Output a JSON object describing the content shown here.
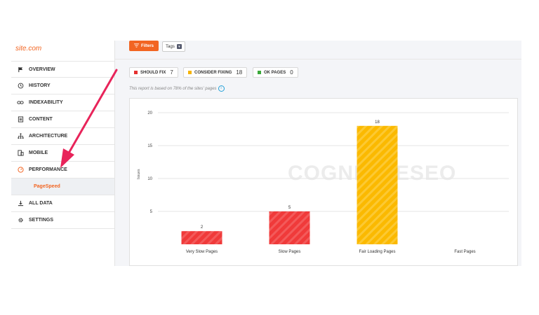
{
  "sidebar": {
    "site_title": "site.com",
    "items": [
      {
        "label": "OVERVIEW",
        "icon": "flag-icon"
      },
      {
        "label": "HISTORY",
        "icon": "history-icon"
      },
      {
        "label": "INDEXABILITY",
        "icon": "link-icon"
      },
      {
        "label": "CONTENT",
        "icon": "document-icon"
      },
      {
        "label": "ARCHITECTURE",
        "icon": "sitemap-icon"
      },
      {
        "label": "MOBILE",
        "icon": "mobile-icon"
      },
      {
        "label": "PERFORMANCE",
        "icon": "speedometer-icon"
      }
    ],
    "subitem": "PageSpeed",
    "items_after": [
      {
        "label": "ALL DATA",
        "icon": "download-icon"
      },
      {
        "label": "SETTINGS",
        "icon": "gear-icon"
      }
    ]
  },
  "toolbar": {
    "filters_label": "Filters",
    "tags_label": "Tags"
  },
  "badges": [
    {
      "label": "SHOULD FIX",
      "count": "7",
      "color": "#e53030"
    },
    {
      "label": "CONSIDER FIXING",
      "count": "18",
      "color": "#f5b300"
    },
    {
      "label": "OK PAGES",
      "count": "0",
      "color": "#3aa83a"
    }
  ],
  "note": "This report is based on 78% of the sites' pages",
  "watermark": "COGNITIVESEO",
  "chart_data": {
    "type": "bar",
    "ylabel": "Issues",
    "ylim": [
      0,
      20
    ],
    "yticks": [
      "20",
      "15",
      "10",
      "5"
    ],
    "categories": [
      "Very Slow Pages",
      "Slow Pages",
      "Fair Loading Pages",
      "Fast Pages"
    ],
    "values": [
      2,
      5,
      18,
      0
    ],
    "colors": [
      "#f03a3a",
      "#f03a3a",
      "#fbb900",
      "#3aa83a"
    ]
  }
}
